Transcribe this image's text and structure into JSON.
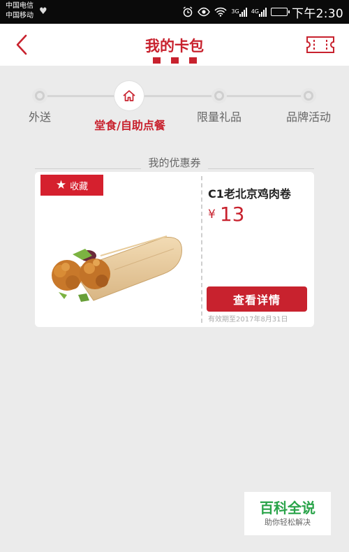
{
  "status_bar": {
    "carrier_1": "中国电信",
    "carrier_2": "中国移动",
    "network_tag_1": "3G",
    "network_tag_2": "4G",
    "time": "下午2:30",
    "battery_level": 0.9
  },
  "header": {
    "title": "我的卡包",
    "back_icon": "chevron-left-icon",
    "ticket_icon": "ticket-icon",
    "accent_color": "#c8222e"
  },
  "tabs": [
    {
      "label": "外送",
      "active": false
    },
    {
      "label": "堂食/自助点餐",
      "active": true,
      "icon": "home-icon"
    },
    {
      "label": "限量礼品",
      "active": false
    },
    {
      "label": "品牌活动",
      "active": false
    }
  ],
  "section": {
    "title": "我的优惠券"
  },
  "coupon": {
    "favorite_label": "收藏",
    "favorite_icon": "star-icon",
    "product_name": "C1老北京鸡肉卷",
    "currency": "¥",
    "price": "13",
    "detail_button": "查看详情",
    "expiry": "有效期至2017年8月31日",
    "image": "chicken-wrap-image"
  },
  "watermark": {
    "main": "百科全说",
    "sub": "助你轻松解决"
  }
}
